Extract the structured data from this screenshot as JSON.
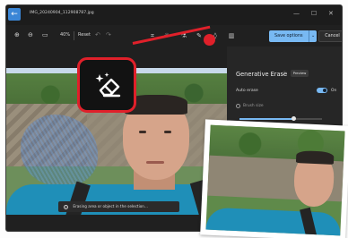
{
  "window": {
    "filename": "IMG_20240904_112908787.jpg",
    "controls": [
      "—",
      "☐",
      "✕"
    ],
    "back_icon": "arrow-left-icon"
  },
  "toolbar": {
    "zoom_percent": "40%",
    "reset_label": "Reset",
    "save_options_label": "Save options",
    "cancel_label": "Cancel",
    "accent_color": "#78b9f3",
    "tool_icons": [
      "crop-icon",
      "adjust-icon",
      "filter-icon",
      "markup-icon",
      "erase-icon",
      "background-icon"
    ]
  },
  "panel": {
    "title": "Generative Erase",
    "badge": "Preview",
    "auto_erase_label": "Auto erase",
    "auto_erase_state": "On",
    "brush_size_label": "Brush size",
    "brush_size_fraction": 0.66
  },
  "status": {
    "message": "Erasing area or object in the selection..."
  },
  "annotation": {
    "callout_color": "#e0202a",
    "callout_icon": "generative-erase-icon"
  }
}
